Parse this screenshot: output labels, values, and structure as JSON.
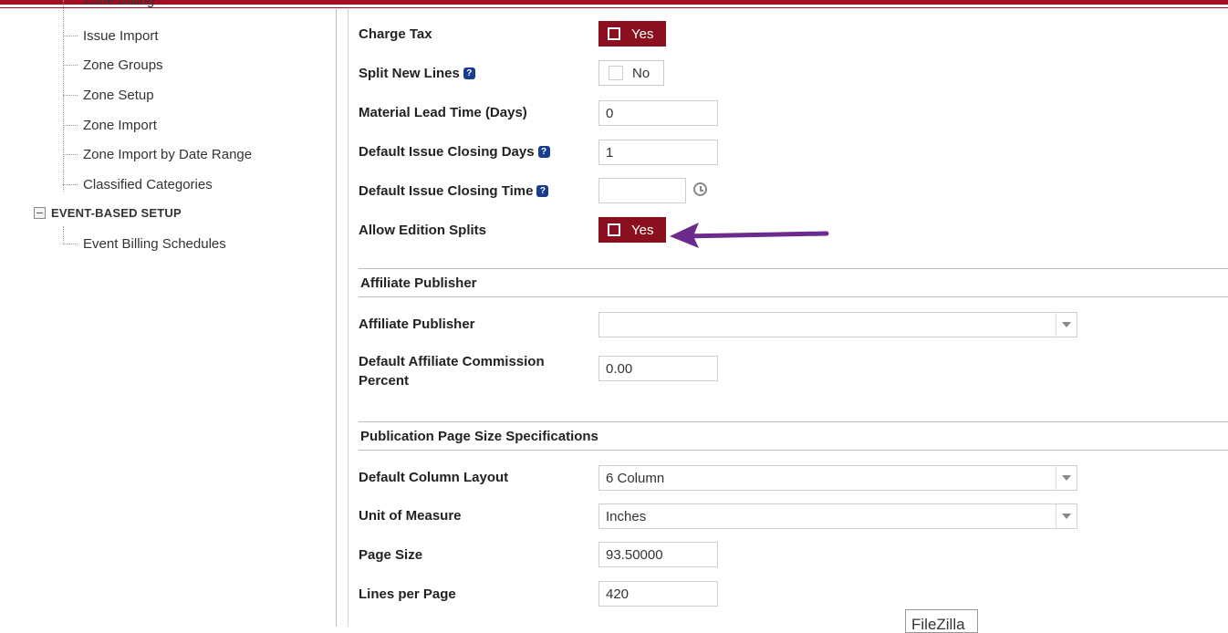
{
  "tree": {
    "cut_item": "Zone Billing",
    "items": [
      {
        "label": "Issue Import"
      },
      {
        "label": "Zone Groups"
      },
      {
        "label": "Zone Setup"
      },
      {
        "label": "Zone Import"
      },
      {
        "label": "Zone Import by Date Range"
      },
      {
        "label": "Classified Categories"
      }
    ],
    "group": {
      "label": "EVENT-BASED SETUP",
      "expander": "−"
    },
    "group_items": [
      {
        "label": "Event Billing Schedules"
      }
    ]
  },
  "form": {
    "charge_tax": {
      "label": "Charge Tax",
      "value": "Yes"
    },
    "split_new_lines": {
      "label": "Split New Lines",
      "value": "No"
    },
    "material_lead_time": {
      "label": "Material Lead Time (Days)",
      "value": "0"
    },
    "default_issue_closing_days": {
      "label": "Default Issue Closing Days",
      "value": "1"
    },
    "default_issue_closing_time": {
      "label": "Default Issue Closing Time",
      "value": ""
    },
    "allow_edition_splits": {
      "label": "Allow Edition Splits",
      "value": "Yes"
    },
    "help_glyph": "?"
  },
  "affiliate": {
    "section_title": "Affiliate Publisher",
    "publisher": {
      "label": "Affiliate Publisher",
      "value": ""
    },
    "commission": {
      "label_line1": "Default Affiliate Commission",
      "label_line2": "Percent",
      "value": "0.00"
    }
  },
  "page_size": {
    "section_title": "Publication Page Size Specifications",
    "column_layout": {
      "label": "Default Column Layout",
      "value": "6 Column"
    },
    "unit_of_measure": {
      "label": "Unit of Measure",
      "value": "Inches"
    },
    "page_size": {
      "label": "Page Size",
      "value": "93.50000"
    },
    "lines_per_page": {
      "label": "Lines per Page",
      "value": "420"
    }
  },
  "tooltip": "FileZilla",
  "colors": {
    "brand": "#a50d22",
    "toggle_on": "#8a1020",
    "help_icon": "#1a3d8f",
    "annotation_arrow": "#6b2a8c"
  }
}
